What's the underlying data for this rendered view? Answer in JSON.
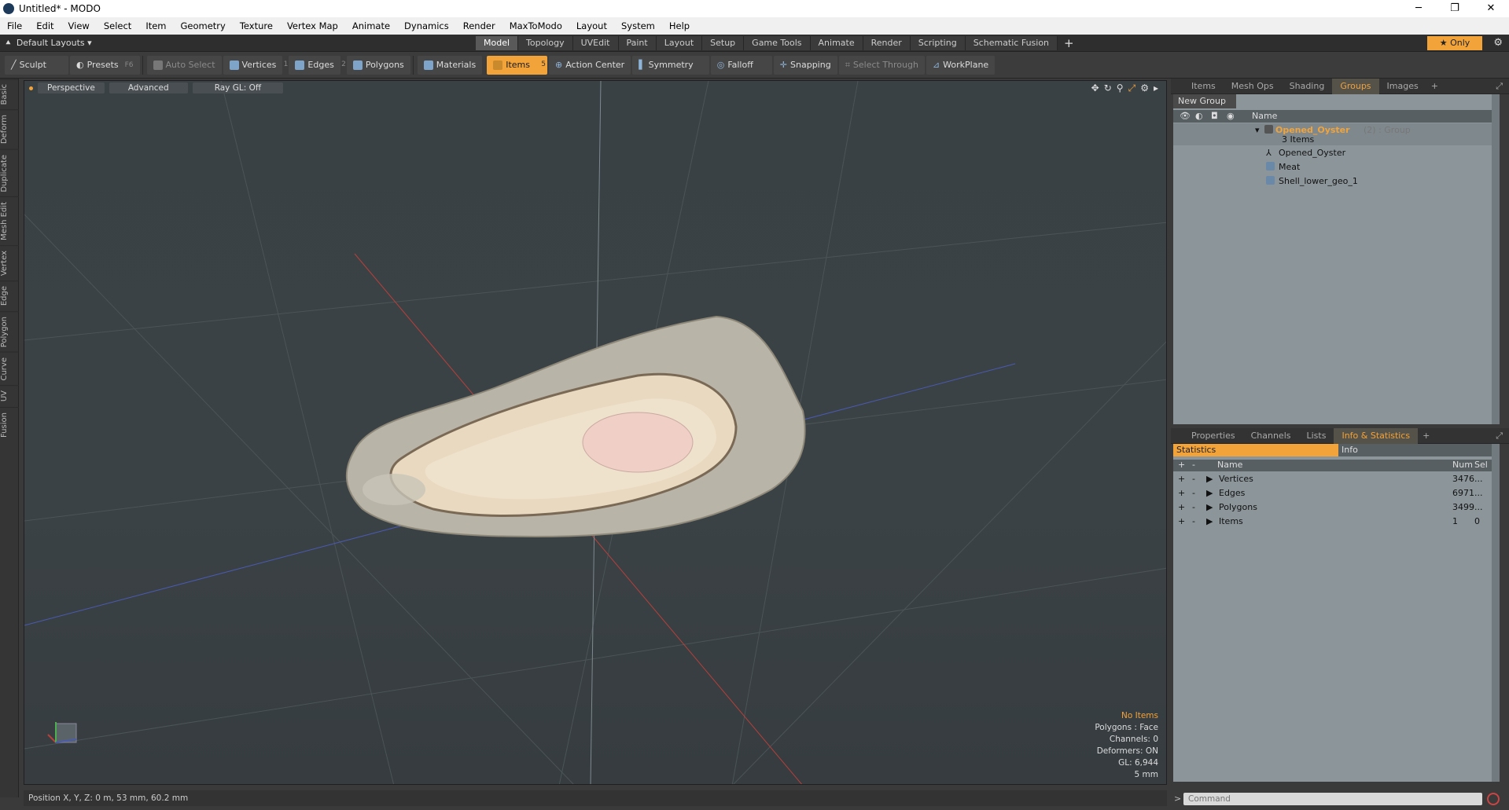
{
  "window": {
    "title": "Untitled* - MODO",
    "controls": [
      "─",
      "❐",
      "✕"
    ]
  },
  "menu": [
    "File",
    "Edit",
    "View",
    "Select",
    "Item",
    "Geometry",
    "Texture",
    "Vertex Map",
    "Animate",
    "Dynamics",
    "Render",
    "MaxToModo",
    "Layout",
    "System",
    "Help"
  ],
  "layoutbar": {
    "layout_label": "Default Layouts ▾",
    "tabs": [
      "Model",
      "Topology",
      "UVEdit",
      "Paint",
      "Layout",
      "Setup",
      "Game Tools",
      "Animate",
      "Render",
      "Scripting",
      "Schematic Fusion"
    ],
    "active_tab": "Model",
    "add": "+",
    "only_label": "★  Only",
    "gear": "⚙"
  },
  "toolbar": {
    "sculpt": "Sculpt",
    "presets": "Presets",
    "presets_key": "F6",
    "auto_select": "Auto Select",
    "vertices": "Vertices",
    "vertices_num": "1",
    "edges": "Edges",
    "edges_num": "2",
    "polygons": "Polygons",
    "materials": "Materials",
    "items": "Items",
    "items_num": "5",
    "action_center": "Action Center",
    "symmetry": "Symmetry",
    "falloff": "Falloff",
    "snapping": "Snapping",
    "select_through": "Select Through",
    "workplane": "WorkPlane"
  },
  "left_tabs": [
    "Basic",
    "Deform",
    "Duplicate",
    "Mesh Edit",
    "Vertex",
    "Edge",
    "Polygon",
    "Curve",
    "UV",
    "Fusion"
  ],
  "viewport": {
    "view_mode": "Perspective",
    "shading": "Advanced",
    "raygl": "Ray GL: Off",
    "info": {
      "no_items": "No Items",
      "polygons": "Polygons : Face",
      "channels": "Channels: 0",
      "deformers": "Deformers: ON",
      "gl": "GL: 6,944",
      "scale": "5 mm"
    }
  },
  "status": {
    "position": "Position X, Y, Z:  0 m, 53 mm, 60.2 mm"
  },
  "upper_panel": {
    "tabs": [
      "Items",
      "Mesh Ops",
      "Shading",
      "Groups",
      "Images"
    ],
    "active_tab": "Groups",
    "new_group": "New Group",
    "name_header": "Name",
    "group": {
      "name": "Opened_Oyster",
      "suffix": "(2) : Group",
      "count": "3 Items"
    },
    "children": [
      "Opened_Oyster",
      "Meat",
      "Shell_lower_geo_1"
    ]
  },
  "lower_panel": {
    "tabs": [
      "Properties",
      "Channels",
      "Lists",
      "Info & Statistics"
    ],
    "active_tab": "Info & Statistics",
    "stat_tab": "Statistics",
    "info_tab": "Info",
    "headers": {
      "name": "Name",
      "num": "Num",
      "sel": "Sel"
    },
    "rows": [
      {
        "name": "Vertices",
        "num": "3476",
        "sel": "..."
      },
      {
        "name": "Edges",
        "num": "6971",
        "sel": "..."
      },
      {
        "name": "Polygons",
        "num": "3499",
        "sel": "..."
      },
      {
        "name": "Items",
        "num": "1",
        "sel": "0"
      }
    ]
  },
  "command": {
    "placeholder": "Command",
    "prompt": ">"
  }
}
